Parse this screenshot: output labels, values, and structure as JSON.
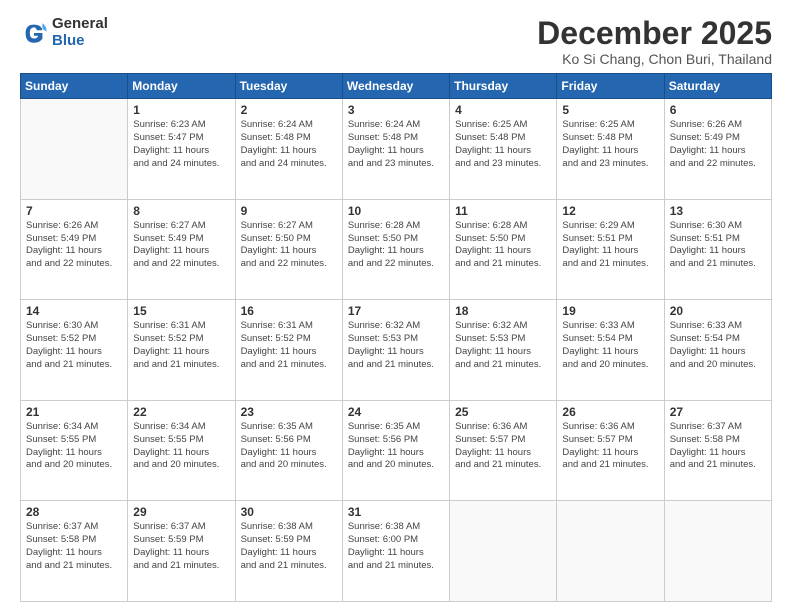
{
  "logo": {
    "general": "General",
    "blue": "Blue"
  },
  "title": "December 2025",
  "location": "Ko Si Chang, Chon Buri, Thailand",
  "days_of_week": [
    "Sunday",
    "Monday",
    "Tuesday",
    "Wednesday",
    "Thursday",
    "Friday",
    "Saturday"
  ],
  "weeks": [
    [
      {
        "day": "",
        "sunrise": "",
        "sunset": "",
        "daylight": ""
      },
      {
        "day": "1",
        "sunrise": "Sunrise: 6:23 AM",
        "sunset": "Sunset: 5:47 PM",
        "daylight": "Daylight: 11 hours and 24 minutes."
      },
      {
        "day": "2",
        "sunrise": "Sunrise: 6:24 AM",
        "sunset": "Sunset: 5:48 PM",
        "daylight": "Daylight: 11 hours and 24 minutes."
      },
      {
        "day": "3",
        "sunrise": "Sunrise: 6:24 AM",
        "sunset": "Sunset: 5:48 PM",
        "daylight": "Daylight: 11 hours and 23 minutes."
      },
      {
        "day": "4",
        "sunrise": "Sunrise: 6:25 AM",
        "sunset": "Sunset: 5:48 PM",
        "daylight": "Daylight: 11 hours and 23 minutes."
      },
      {
        "day": "5",
        "sunrise": "Sunrise: 6:25 AM",
        "sunset": "Sunset: 5:48 PM",
        "daylight": "Daylight: 11 hours and 23 minutes."
      },
      {
        "day": "6",
        "sunrise": "Sunrise: 6:26 AM",
        "sunset": "Sunset: 5:49 PM",
        "daylight": "Daylight: 11 hours and 22 minutes."
      }
    ],
    [
      {
        "day": "7",
        "sunrise": "Sunrise: 6:26 AM",
        "sunset": "Sunset: 5:49 PM",
        "daylight": "Daylight: 11 hours and 22 minutes."
      },
      {
        "day": "8",
        "sunrise": "Sunrise: 6:27 AM",
        "sunset": "Sunset: 5:49 PM",
        "daylight": "Daylight: 11 hours and 22 minutes."
      },
      {
        "day": "9",
        "sunrise": "Sunrise: 6:27 AM",
        "sunset": "Sunset: 5:50 PM",
        "daylight": "Daylight: 11 hours and 22 minutes."
      },
      {
        "day": "10",
        "sunrise": "Sunrise: 6:28 AM",
        "sunset": "Sunset: 5:50 PM",
        "daylight": "Daylight: 11 hours and 22 minutes."
      },
      {
        "day": "11",
        "sunrise": "Sunrise: 6:28 AM",
        "sunset": "Sunset: 5:50 PM",
        "daylight": "Daylight: 11 hours and 21 minutes."
      },
      {
        "day": "12",
        "sunrise": "Sunrise: 6:29 AM",
        "sunset": "Sunset: 5:51 PM",
        "daylight": "Daylight: 11 hours and 21 minutes."
      },
      {
        "day": "13",
        "sunrise": "Sunrise: 6:30 AM",
        "sunset": "Sunset: 5:51 PM",
        "daylight": "Daylight: 11 hours and 21 minutes."
      }
    ],
    [
      {
        "day": "14",
        "sunrise": "Sunrise: 6:30 AM",
        "sunset": "Sunset: 5:52 PM",
        "daylight": "Daylight: 11 hours and 21 minutes."
      },
      {
        "day": "15",
        "sunrise": "Sunrise: 6:31 AM",
        "sunset": "Sunset: 5:52 PM",
        "daylight": "Daylight: 11 hours and 21 minutes."
      },
      {
        "day": "16",
        "sunrise": "Sunrise: 6:31 AM",
        "sunset": "Sunset: 5:52 PM",
        "daylight": "Daylight: 11 hours and 21 minutes."
      },
      {
        "day": "17",
        "sunrise": "Sunrise: 6:32 AM",
        "sunset": "Sunset: 5:53 PM",
        "daylight": "Daylight: 11 hours and 21 minutes."
      },
      {
        "day": "18",
        "sunrise": "Sunrise: 6:32 AM",
        "sunset": "Sunset: 5:53 PM",
        "daylight": "Daylight: 11 hours and 21 minutes."
      },
      {
        "day": "19",
        "sunrise": "Sunrise: 6:33 AM",
        "sunset": "Sunset: 5:54 PM",
        "daylight": "Daylight: 11 hours and 20 minutes."
      },
      {
        "day": "20",
        "sunrise": "Sunrise: 6:33 AM",
        "sunset": "Sunset: 5:54 PM",
        "daylight": "Daylight: 11 hours and 20 minutes."
      }
    ],
    [
      {
        "day": "21",
        "sunrise": "Sunrise: 6:34 AM",
        "sunset": "Sunset: 5:55 PM",
        "daylight": "Daylight: 11 hours and 20 minutes."
      },
      {
        "day": "22",
        "sunrise": "Sunrise: 6:34 AM",
        "sunset": "Sunset: 5:55 PM",
        "daylight": "Daylight: 11 hours and 20 minutes."
      },
      {
        "day": "23",
        "sunrise": "Sunrise: 6:35 AM",
        "sunset": "Sunset: 5:56 PM",
        "daylight": "Daylight: 11 hours and 20 minutes."
      },
      {
        "day": "24",
        "sunrise": "Sunrise: 6:35 AM",
        "sunset": "Sunset: 5:56 PM",
        "daylight": "Daylight: 11 hours and 20 minutes."
      },
      {
        "day": "25",
        "sunrise": "Sunrise: 6:36 AM",
        "sunset": "Sunset: 5:57 PM",
        "daylight": "Daylight: 11 hours and 21 minutes."
      },
      {
        "day": "26",
        "sunrise": "Sunrise: 6:36 AM",
        "sunset": "Sunset: 5:57 PM",
        "daylight": "Daylight: 11 hours and 21 minutes."
      },
      {
        "day": "27",
        "sunrise": "Sunrise: 6:37 AM",
        "sunset": "Sunset: 5:58 PM",
        "daylight": "Daylight: 11 hours and 21 minutes."
      }
    ],
    [
      {
        "day": "28",
        "sunrise": "Sunrise: 6:37 AM",
        "sunset": "Sunset: 5:58 PM",
        "daylight": "Daylight: 11 hours and 21 minutes."
      },
      {
        "day": "29",
        "sunrise": "Sunrise: 6:37 AM",
        "sunset": "Sunset: 5:59 PM",
        "daylight": "Daylight: 11 hours and 21 minutes."
      },
      {
        "day": "30",
        "sunrise": "Sunrise: 6:38 AM",
        "sunset": "Sunset: 5:59 PM",
        "daylight": "Daylight: 11 hours and 21 minutes."
      },
      {
        "day": "31",
        "sunrise": "Sunrise: 6:38 AM",
        "sunset": "Sunset: 6:00 PM",
        "daylight": "Daylight: 11 hours and 21 minutes."
      },
      {
        "day": "",
        "sunrise": "",
        "sunset": "",
        "daylight": ""
      },
      {
        "day": "",
        "sunrise": "",
        "sunset": "",
        "daylight": ""
      },
      {
        "day": "",
        "sunrise": "",
        "sunset": "",
        "daylight": ""
      }
    ]
  ]
}
